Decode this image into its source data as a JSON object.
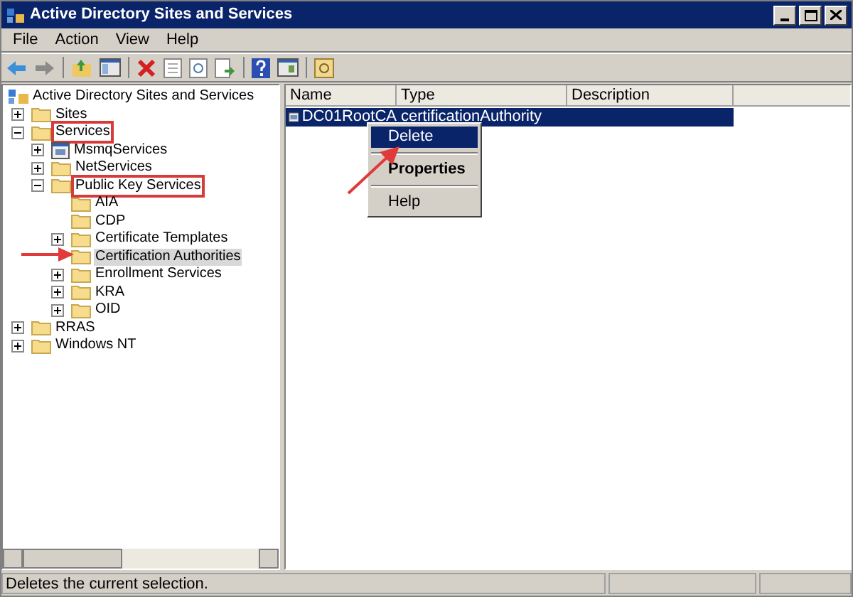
{
  "window": {
    "title": "Active Directory Sites and Services"
  },
  "menu": [
    "File",
    "Action",
    "View",
    "Help"
  ],
  "tree": {
    "label": "Active Directory Sites and Services",
    "kind": "root",
    "children": [
      {
        "label": "Sites",
        "kind": "folder",
        "expanded": false,
        "selected": false,
        "annotated": false
      },
      {
        "label": "Services",
        "kind": "folder",
        "expanded": true,
        "selected": false,
        "annotated": true,
        "children": [
          {
            "label": "MsmqServices",
            "kind": "server",
            "expanded": false,
            "selected": false,
            "annotated": false
          },
          {
            "label": "NetServices",
            "kind": "folder",
            "expanded": false,
            "selected": false,
            "annotated": false
          },
          {
            "label": "Public Key Services",
            "kind": "folder",
            "expanded": true,
            "selected": false,
            "annotated": true,
            "children": [
              {
                "label": "AIA",
                "kind": "folder",
                "selected": false,
                "annotated": false
              },
              {
                "label": "CDP",
                "kind": "folder",
                "selected": false,
                "annotated": false
              },
              {
                "label": "Certificate Templates",
                "kind": "folder",
                "expanded": false,
                "selected": false,
                "annotated": false
              },
              {
                "label": "Certification Authorities",
                "kind": "folder",
                "selected": true,
                "annotated": false
              },
              {
                "label": "Enrollment Services",
                "kind": "folder",
                "expanded": false,
                "selected": false,
                "annotated": false
              },
              {
                "label": "KRA",
                "kind": "folder",
                "expanded": false,
                "selected": false,
                "annotated": false
              },
              {
                "label": "OID",
                "kind": "folder",
                "expanded": false,
                "selected": false,
                "annotated": false
              }
            ]
          }
        ]
      },
      {
        "label": "RRAS",
        "kind": "folder",
        "expanded": false,
        "selected": false,
        "annotated": false
      },
      {
        "label": "Windows NT",
        "kind": "folder",
        "expanded": false,
        "selected": false,
        "annotated": false
      }
    ]
  },
  "list": {
    "columns": [
      "Name",
      "Type",
      "Description"
    ],
    "rows": [
      {
        "name": "DC01RootCA",
        "type": "certificationAuthority",
        "selected": true
      }
    ]
  },
  "context_menu": [
    {
      "kind": "item",
      "label": "Delete",
      "selected": true,
      "default": false
    },
    {
      "kind": "separator"
    },
    {
      "kind": "item",
      "label": "Properties",
      "selected": false,
      "default": true
    },
    {
      "kind": "separator"
    },
    {
      "kind": "item",
      "label": "Help",
      "selected": false,
      "default": false
    }
  ],
  "status_bar": {
    "text": "Deletes the current selection."
  }
}
